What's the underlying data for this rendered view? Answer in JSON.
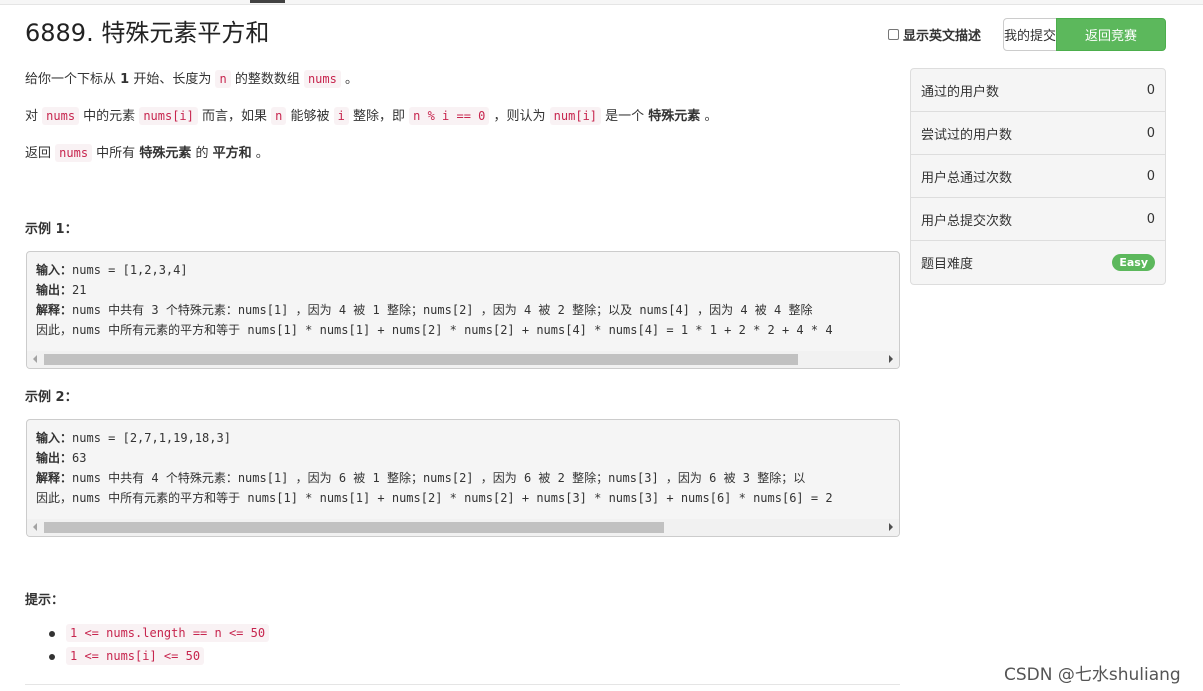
{
  "page": {
    "title": "6889. 特殊元素平方和"
  },
  "toolbar": {
    "english_toggle_label": "显示英文描述",
    "my_submissions_label": "我的提交",
    "back_to_contest_label": "返回竞赛"
  },
  "description": {
    "p1": {
      "a": "给你一个下标从 ",
      "b": "1",
      "c": " 开始、长度为 ",
      "d": "n",
      "e": " 的整数数组 ",
      "f": "nums",
      "g": " 。"
    },
    "p2": {
      "a": "对 ",
      "b": "nums",
      "c": " 中的元素 ",
      "d": "nums[i]",
      "e": " 而言，如果 ",
      "f": "n",
      "g": " 能够被 ",
      "h": "i",
      "i": " 整除，即 ",
      "j": "n % i == 0",
      "k": " ，则认为 ",
      "l": "num[i]",
      "m": " 是一个 ",
      "n": "特殊元素",
      "o": " 。"
    },
    "p3": {
      "a": "返回 ",
      "b": "nums",
      "c": " 中所有 ",
      "d": "特殊元素",
      "e": " 的 ",
      "f": "平方和",
      "g": " 。"
    }
  },
  "examples": [
    {
      "title": "示例 1：",
      "input_label": "输入：",
      "input_value": "nums = [1,2,3,4]",
      "output_label": "输出：",
      "output_value": "21",
      "explain_label": "解释：",
      "explain_value": "nums 中共有 3 个特殊元素：nums[1] ，因为 4 被 1 整除；nums[2] ，因为 4 被 2 整除；以及 nums[4] ，因为 4 被 4 整除",
      "line4": "因此，nums 中所有元素的平方和等于 nums[1] * nums[1] + nums[2] * nums[2] + nums[4] * nums[4] = 1 * 1 + 2 * 2 + 4 * 4",
      "scroll_fraction": 0.9
    },
    {
      "title": "示例 2：",
      "input_label": "输入：",
      "input_value": "nums = [2,7,1,19,18,3]",
      "output_label": "输出：",
      "output_value": "63",
      "explain_label": "解释：",
      "explain_value": "nums 中共有 4 个特殊元素：nums[1] ，因为 6 被 1 整除；nums[2] ，因为 6 被 2 整除；nums[3] ，因为 6 被 3 整除；以",
      "line4": "因此，nums 中所有元素的平方和等于 nums[1] * nums[1] + nums[2] * nums[2] + nums[3] * nums[3] + nums[6] * nums[6] = 2",
      "scroll_fraction": 0.74
    }
  ],
  "hints": {
    "title": "提示：",
    "items": [
      "1 <= nums.length == n <= 50",
      "1 <= nums[i] <= 50"
    ]
  },
  "stats": {
    "rows": [
      {
        "label": "通过的用户数",
        "value": "0"
      },
      {
        "label": "尝试过的用户数",
        "value": "0"
      },
      {
        "label": "用户总通过次数",
        "value": "0"
      },
      {
        "label": "用户总提交次数",
        "value": "0"
      }
    ],
    "difficulty_label": "题目难度",
    "difficulty_value": "Easy"
  },
  "colors": {
    "accent_green": "#5cb85c",
    "code_red": "#c7254e"
  },
  "watermark": "CSDN @七水shuliang"
}
